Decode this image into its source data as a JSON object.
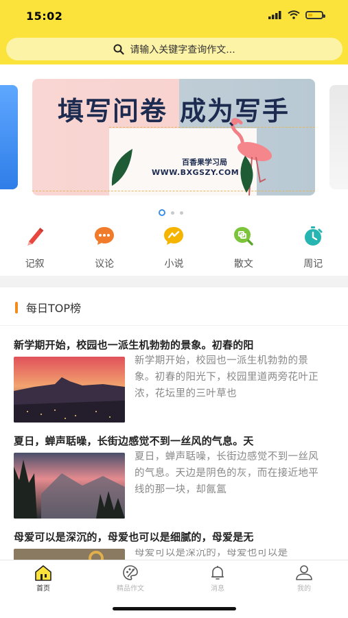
{
  "status": {
    "time": "15:02"
  },
  "search": {
    "placeholder": "请输入关键字查询作文..."
  },
  "banner": {
    "title_left": "填写问卷",
    "title_right": "成为写手",
    "line1": "百香果学习局",
    "line2": "WWW.BXGSZY.COM",
    "page_count": 3,
    "active_index": 0
  },
  "categories": [
    {
      "label": "记叙",
      "icon": "pencil-icon",
      "color": "#e8473f"
    },
    {
      "label": "议论",
      "icon": "chat-bubble-icon",
      "color": "#f07b2b"
    },
    {
      "label": "小说",
      "icon": "lightning-bubble-icon",
      "color": "#f5b400"
    },
    {
      "label": "散文",
      "icon": "search-bubble-icon",
      "color": "#7cc43a"
    },
    {
      "label": "周记",
      "icon": "stopwatch-icon",
      "color": "#26b5b0"
    }
  ],
  "section": {
    "title": "每日TOP榜",
    "accent": "#f28a1e"
  },
  "articles": [
    {
      "title": "新学期开始，校园也一派生机勃勃的景象。初春的阳",
      "excerpt": "新学期开始，校园也一派生机勃勃的景象。初春的阳光下，校园里道两旁花叶正浓，花坛里的三叶草也"
    },
    {
      "title": "夏日，蝉声聒噪，长街边感觉不到一丝风的气息。天",
      "excerpt": "夏日，蝉声聒噪，长街边感觉不到一丝风的气息。天边是阴色的灰，而在接近地平线的那一块，却氤氲"
    },
    {
      "title": "母爱可以是深沉的，母爱也可以是细腻的，母爱是无",
      "excerpt": "母爱可以是深沉的，母爱也可以是"
    }
  ],
  "tabbar": [
    {
      "label": "首页",
      "icon": "home-icon",
      "active": true
    },
    {
      "label": "精品作文",
      "icon": "palette-icon",
      "active": false
    },
    {
      "label": "消息",
      "icon": "bell-icon",
      "active": false
    },
    {
      "label": "我的",
      "icon": "user-icon",
      "active": false
    }
  ],
  "colors": {
    "brand": "#fce33b",
    "search_bg": "#fdf3a6",
    "active_dot": "#3a8ee6"
  }
}
